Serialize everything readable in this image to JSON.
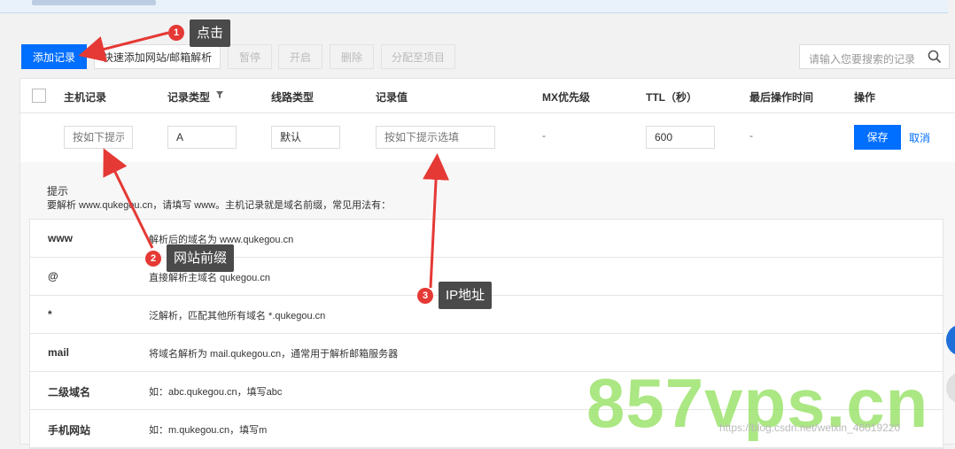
{
  "toolbar": {
    "add_record": "添加记录",
    "quick_add": "快速添加网站/邮箱解析",
    "pause": "暂停",
    "enable": "开启",
    "delete": "删除",
    "assign": "分配至项目",
    "search_placeholder": "请输入您要搜索的记录"
  },
  "table": {
    "headers": [
      "主机记录",
      "记录类型",
      "线路类型",
      "记录值",
      "MX优先级",
      "TTL（秒）",
      "最后操作时间",
      "操作"
    ],
    "edit_row": {
      "host_placeholder": "按如下提示",
      "type_value": "A",
      "line_value": "默认",
      "value_placeholder": "按如下提示选填",
      "mx": "-",
      "ttl": "600",
      "last_time": "-",
      "save": "保存",
      "cancel": "取消"
    }
  },
  "hint": {
    "title": "提示",
    "desc": "要解析 www.qukegou.cn，请填写 www。主机记录就是域名前缀，常见用法有：",
    "examples": [
      {
        "key": "www",
        "text": "解析后的域名为 www.qukegou.cn"
      },
      {
        "key": "@",
        "text": "直接解析主域名 qukegou.cn"
      },
      {
        "key": "*",
        "text": "泛解析，匹配其他所有域名 *.qukegou.cn"
      },
      {
        "key": "mail",
        "text": "将域名解析为 mail.qukegou.cn，通常用于解析邮箱服务器"
      },
      {
        "key": "二级域名",
        "text": "如：abc.qukegou.cn，填写abc"
      },
      {
        "key": "手机网站",
        "text": "如：m.qukegou.cn，填写m"
      }
    ]
  },
  "annotations": [
    {
      "num": "1",
      "label": "点击"
    },
    {
      "num": "2",
      "label": "网站前缀"
    },
    {
      "num": "3",
      "label": "IP地址"
    }
  ],
  "watermark": {
    "big": "857vps.cn",
    "small": "https://blog.csdn.net/weixin_46019220"
  },
  "colors": {
    "primary": "#006eff",
    "annotation_red": "#e53935",
    "watermark_green": "#8fe05a"
  }
}
